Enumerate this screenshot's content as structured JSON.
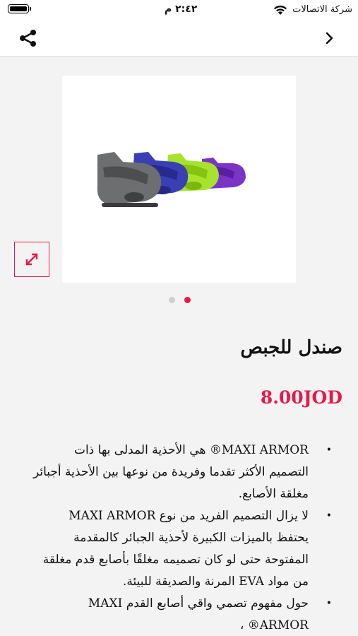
{
  "status_bar": {
    "carrier": "شركة الاتصالات",
    "time": "٢:٤٢ م",
    "wifi_icon": "wifi-icon",
    "battery_icon": "battery-icon"
  },
  "nav": {
    "share_icon": "share-icon",
    "back_icon": "chevron-right-icon"
  },
  "gallery": {
    "image": "post-op-shoes-product-image",
    "zoom_icon": "expand-icon",
    "slide_count": 2,
    "active_slide": 2
  },
  "product": {
    "title": "صندل للجبص",
    "price": "8.00JOD",
    "description": [
      "MAXI ARMOR® هي الأحذية المدلى بها ذات التصميم الأكثر تقدما وفريدة من نوعها بين الأحذية أجبائر مغلقة الأصابع.",
      "لا يزال التصميم الفريد من نوع MAXI ARMOR يحتفظ بالميزات الكبيرة لأحذية الجبائر كالمقدمة المفتوحة حتى لو كان تصميمه مغلقًا بأصابع قدم مغلقة من مواد EVA المرنة والصديقة للبيئة.",
      "حول مفهوم تصمي واقي أصابع القدم MAXI ARMOR® ،"
    ]
  },
  "colors": {
    "accent": "#e6194b",
    "background": "#f3f3f3"
  }
}
